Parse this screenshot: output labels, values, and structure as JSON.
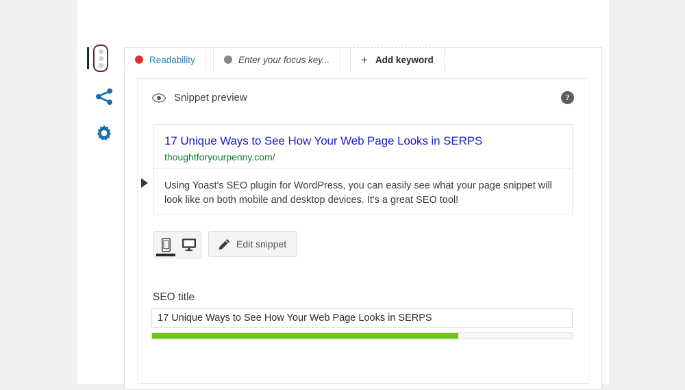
{
  "window": {
    "background_color": "#f0f0f0",
    "sheet_color": "#ffffff"
  },
  "sidebar_rail": {
    "items": [
      {
        "name": "traffic-light-indicator",
        "icon": "traffic-light-icon",
        "active": true
      },
      {
        "name": "share-button",
        "icon": "share-icon",
        "color": "#1b6ca8"
      },
      {
        "name": "settings-button",
        "icon": "gear-icon",
        "color": "#1b6ca8"
      }
    ]
  },
  "tabs": [
    {
      "id": "readability",
      "label": "Readability",
      "dot": "red",
      "dot_color": "#dc3232",
      "active": true
    },
    {
      "id": "focus-keyword",
      "label": "Enter your focus key...",
      "dot": "grey",
      "dot_color": "#888888",
      "active": false
    },
    {
      "id": "add-keyword",
      "label": "Add keyword",
      "plus": "+",
      "active": false
    }
  ],
  "snippet_preview": {
    "header_label": "Snippet preview",
    "eye_icon": "eye-icon",
    "help_icon": "help-icon",
    "help_glyph": "?",
    "title": "17 Unique Ways to See How Your Web Page Looks in SERPS",
    "title_color": "#2020c0",
    "url": "thoughtforyourpenny.com/",
    "url_color": "#0a7a26",
    "description": "Using Yoast's SEO plugin for WordPress, you can easily see what your page snippet will look like on both mobile and desktop devices. It's a great SEO tool!"
  },
  "controls": {
    "device_toggle": {
      "mobile": {
        "label": "mobile",
        "icon": "mobile-icon",
        "active": true
      },
      "desktop": {
        "label": "desktop",
        "icon": "desktop-icon",
        "active": false
      }
    },
    "edit_snippet": {
      "label": "Edit snippet",
      "icon": "pencil-icon"
    }
  },
  "seo_title": {
    "label": "SEO title",
    "value": "17 Unique Ways to See How Your Web Page Looks in SERPS",
    "placeholder": "SEO title",
    "progress_percent": 73,
    "progress_color": "#6ec418"
  }
}
